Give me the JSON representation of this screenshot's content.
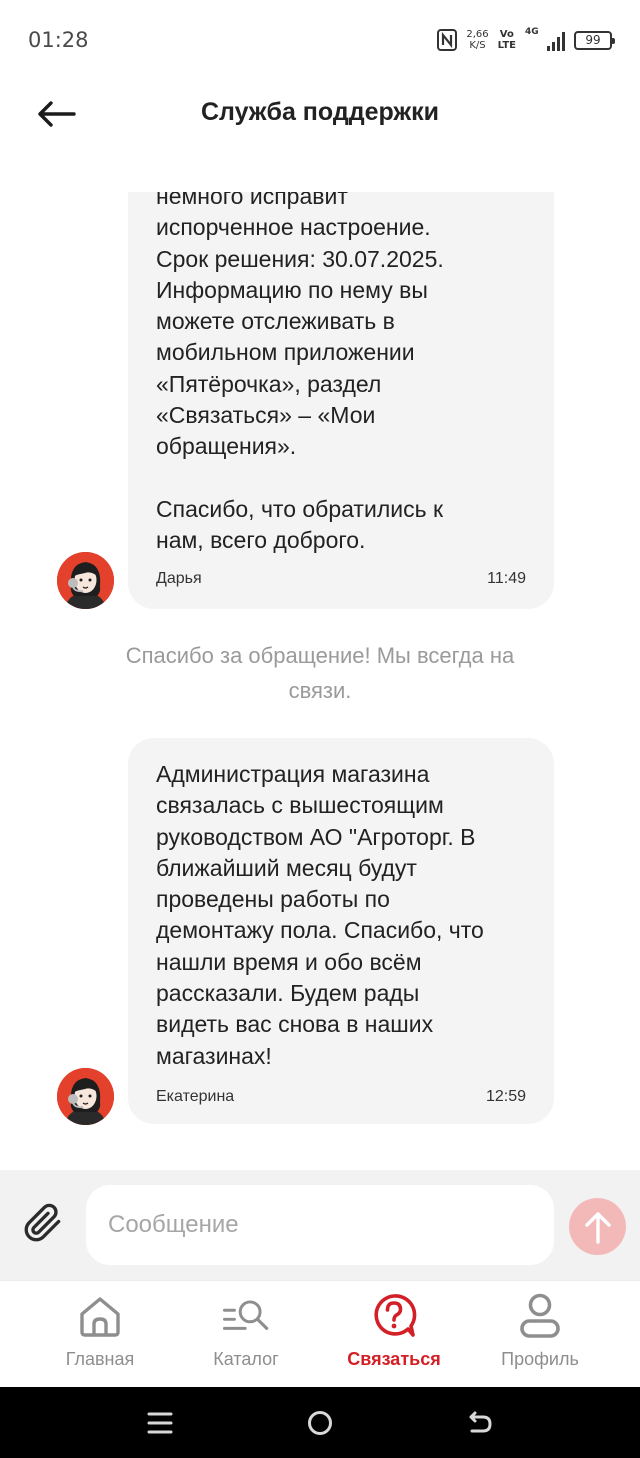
{
  "status_bar": {
    "time": "01:28",
    "speed_value": "2,66",
    "speed_unit": "K/S",
    "volte_top": "Vo",
    "volte_bottom": "LTE",
    "network": "4G",
    "battery": "99"
  },
  "header": {
    "title": "Служба поддержки"
  },
  "chat": {
    "messages": [
      {
        "text": "немного исправит\nиспорченное настроение.\nСрок решения: 30.07.2025.\nИнформацию по нему вы\nможете отслеживать в\nмобильном приложении\n«Пятёрочка», раздел\n«Связаться» – «Мои\nобращения».\n\nСпасибо, что обратились к\nнам, всего доброго.",
        "author": "Дарья",
        "time": "11:49"
      },
      {
        "text": "Администрация магазина\nсвязалась с вышестоящим\nруководством АО \"Агроторг. В\nближайший месяц будут\nпроведены работы по\nдемонтажу пола. Спасибо, что\nнашли время и обо всём\nрассказали. Будем рады\nвидеть вас снова в наших\nмагазинах!",
        "author": "Екатерина",
        "time": "12:59"
      }
    ],
    "system_note": "Спасибо за обращение! Мы всегда на связи."
  },
  "composer": {
    "placeholder": "Сообщение"
  },
  "bottom_nav": {
    "items": [
      {
        "label": "Главная",
        "icon": "home-icon"
      },
      {
        "label": "Каталог",
        "icon": "catalog-search-icon"
      },
      {
        "label": "Связаться",
        "icon": "support-question-icon"
      },
      {
        "label": "Профиль",
        "icon": "profile-icon"
      }
    ],
    "active_index": 2
  },
  "colors": {
    "accent": "#d31f26",
    "send_button": "#f3b9b9",
    "bubble": "#f4f4f4",
    "avatar": "#e3412c"
  }
}
